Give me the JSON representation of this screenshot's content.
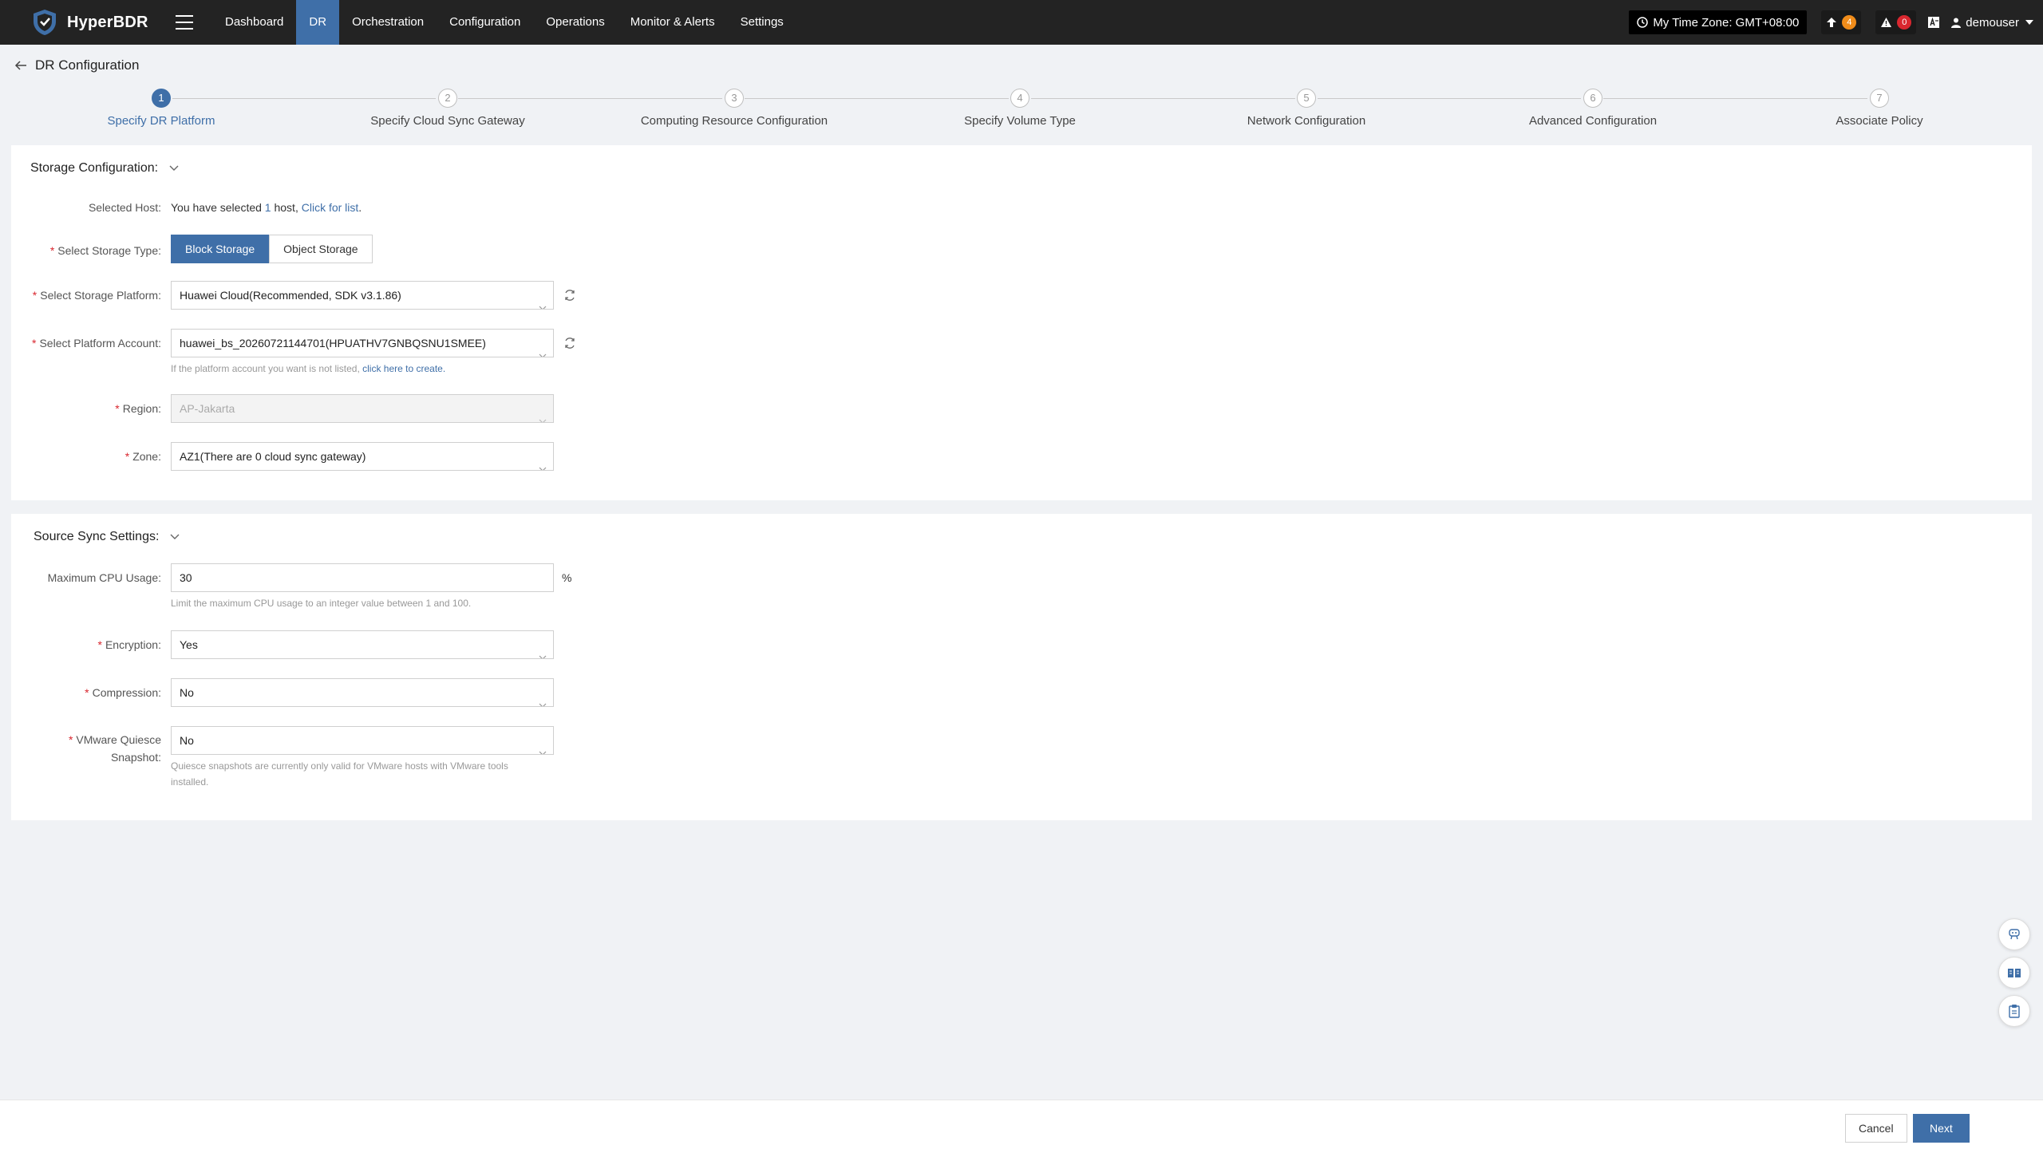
{
  "app": {
    "name": "HyperBDR",
    "icons": {
      "logo": "shield-logo",
      "menu": "hamburger-icon"
    }
  },
  "nav": {
    "items": [
      {
        "label": "Dashboard",
        "active": false
      },
      {
        "label": "DR",
        "active": true
      },
      {
        "label": "Orchestration",
        "active": false
      },
      {
        "label": "Configuration",
        "active": false
      },
      {
        "label": "Operations",
        "active": false
      },
      {
        "label": "Monitor & Alerts",
        "active": false
      },
      {
        "label": "Settings",
        "active": false
      }
    ],
    "active_color": "#3f6fa8"
  },
  "topbar": {
    "timezone_label": "My Time Zone: GMT+08:00",
    "upgrade_count": "4",
    "alert_count": "0",
    "username": "demouser"
  },
  "page": {
    "title": "DR Configuration"
  },
  "stepper": {
    "steps": [
      {
        "number": "1",
        "label": "Specify DR Platform",
        "active": true
      },
      {
        "number": "2",
        "label": "Specify Cloud Sync Gateway",
        "active": false
      },
      {
        "number": "3",
        "label": "Computing Resource Configuration",
        "active": false
      },
      {
        "number": "4",
        "label": "Specify Volume Type",
        "active": false
      },
      {
        "number": "5",
        "label": "Network Configuration",
        "active": false
      },
      {
        "number": "6",
        "label": "Advanced Configuration",
        "active": false
      },
      {
        "number": "7",
        "label": "Associate Policy",
        "active": false
      }
    ]
  },
  "storage": {
    "title": "Storage Configuration:",
    "selected_host_label": "Selected Host:",
    "selected_host_prefix": "You have selected ",
    "selected_host_count": "1",
    "selected_host_suffix": " host, ",
    "selected_host_link": "Click for list",
    "selected_host_end": ".",
    "storage_type_label": "Select Storage Type:",
    "storage_type_options": [
      "Block Storage",
      "Object Storage"
    ],
    "storage_type_selected": "Block Storage",
    "platform_label": "Select Storage Platform:",
    "platform_value": "Huawei Cloud(Recommended, SDK v3.1.86)",
    "account_label": "Select Platform Account:",
    "account_value": "huawei_bs_20260721144701(HPUATHV7GNBQSNU1SMEE)",
    "account_hint": "If the platform account you want is not listed, ",
    "account_hint_link": "click here to create.",
    "region_label": "Region:",
    "region_value": "AP-Jakarta",
    "zone_label": "Zone:",
    "zone_value": "AZ1(There are 0 cloud sync gateway)"
  },
  "sync": {
    "title": "Source Sync Settings:",
    "cpu_label": "Maximum CPU Usage:",
    "cpu_value": "30",
    "cpu_unit": "%",
    "cpu_hint": "Limit the maximum CPU usage to an integer value between 1 and 100.",
    "encryption_label": "Encryption:",
    "encryption_value": "Yes",
    "compression_label": "Compression:",
    "compression_value": "No",
    "quiesce_label_line1": "VMware Quiesce",
    "quiesce_label_line2": "Snapshot:",
    "quiesce_value": "No",
    "quiesce_hint_line1": "Quiesce snapshots are currently only valid for VMware hosts with VMware tools",
    "quiesce_hint_line2": "installed."
  },
  "footer": {
    "cancel_label": "Cancel",
    "next_label": "Next"
  }
}
